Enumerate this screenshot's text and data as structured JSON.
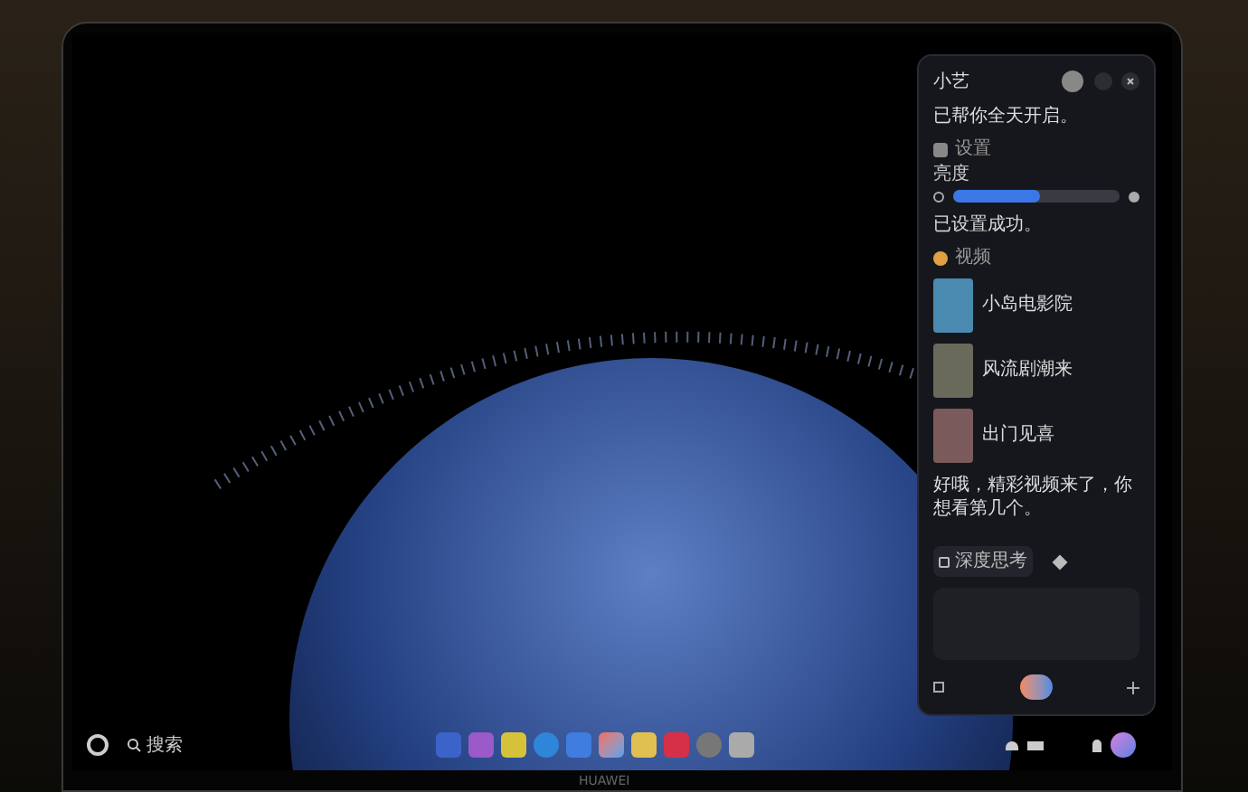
{
  "assistant_panel": {
    "title": "小艺",
    "messages": [
      {
        "kind": "text",
        "text": "已帮你全天开启。"
      },
      {
        "kind": "setting",
        "source": "设置",
        "label": "亮度",
        "level": 0.52
      },
      {
        "kind": "text",
        "text": "已设置成功。"
      },
      {
        "kind": "videos",
        "source": "视频",
        "items": [
          {
            "title": "小岛电影院"
          },
          {
            "title": "风流剧潮来"
          },
          {
            "title": "出门见喜"
          }
        ]
      },
      {
        "kind": "text",
        "text": "好哦，精彩视频来了，你想看第几个。"
      }
    ],
    "deep_think": "深度思考"
  },
  "taskbar": {
    "search": "搜索"
  },
  "brand": "HUAWEI"
}
